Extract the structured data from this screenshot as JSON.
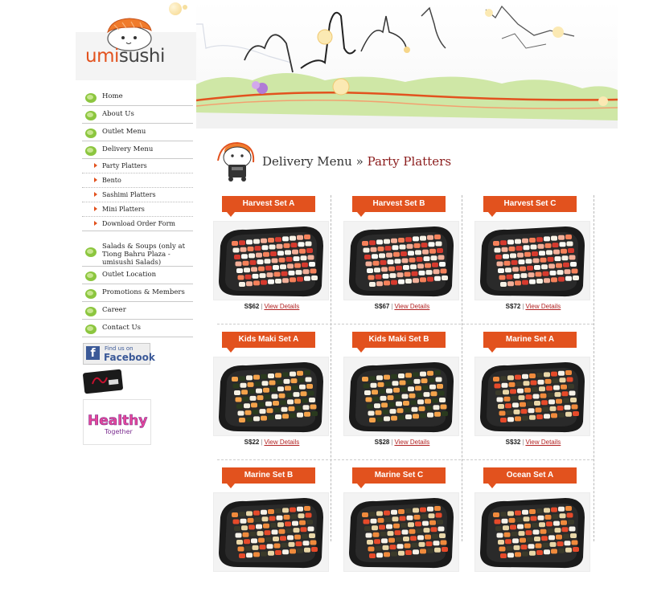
{
  "brand": {
    "logo_umi": "umi",
    "logo_sushi": "sushi"
  },
  "nav": {
    "main_top": [
      "Home",
      "About Us",
      "Outlet Menu",
      "Delivery Menu"
    ],
    "sub": [
      "Party Platters",
      "Bento",
      "Sashimi Platters",
      "Mini Platters",
      "Download Order Form"
    ],
    "main_bottom": [
      "Salads & Soups (only at Tiong Bahru Plaza - umisushi Salads)",
      "Outlet Location",
      "Promotions & Members",
      "Career",
      "Contact Us"
    ]
  },
  "social": {
    "fb_small": "Find us on",
    "fb_big": "Facebook",
    "healthy": "Healthy",
    "together": "Together"
  },
  "heading": {
    "section": "Delivery Menu",
    "separator": "»",
    "current": "Party Platters"
  },
  "products": [
    {
      "name": "Harvest Set A",
      "price": "S$62",
      "link": "View Details"
    },
    {
      "name": "Harvest Set B",
      "price": "S$67",
      "link": "View Details"
    },
    {
      "name": "Harvest Set C",
      "price": "S$72",
      "link": "View Details"
    },
    {
      "name": "Kids Maki Set A",
      "price": "S$22",
      "link": "View Details"
    },
    {
      "name": "Kids Maki Set B",
      "price": "S$28",
      "link": "View Details"
    },
    {
      "name": "Marine Set A",
      "price": "S$32",
      "link": "View Details"
    },
    {
      "name": "Marine Set B",
      "price": "",
      "link": ""
    },
    {
      "name": "Marine Set C",
      "price": "",
      "link": ""
    },
    {
      "name": "Ocean Set A",
      "price": "",
      "link": ""
    }
  ],
  "colors": {
    "accent": "#e2521e",
    "leaf": "#8cc63f",
    "heading_current": "#8b1c1c"
  }
}
